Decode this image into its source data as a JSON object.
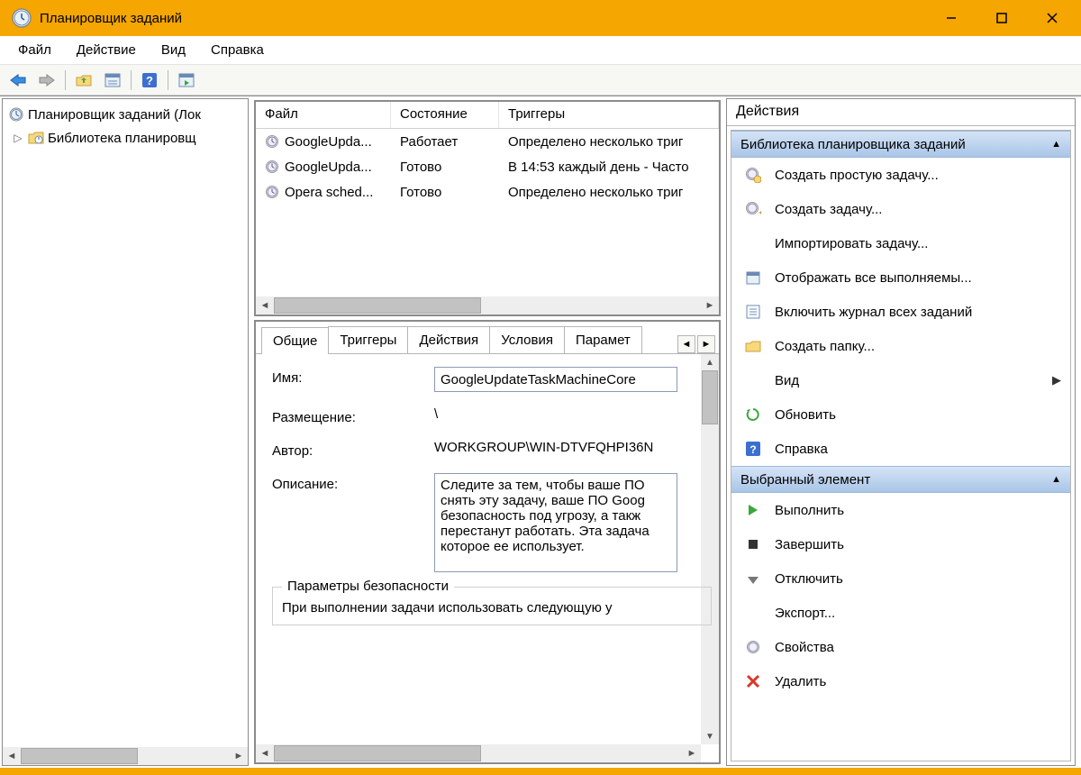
{
  "window": {
    "title": "Планировщик заданий"
  },
  "menu": {
    "file": "Файл",
    "action": "Действие",
    "view": "Вид",
    "help": "Справка"
  },
  "tree": {
    "root": "Планировщик заданий (Лок",
    "library": "Библиотека планировщ"
  },
  "table": {
    "headers": {
      "file": "Файл",
      "state": "Состояние",
      "triggers": "Триггеры"
    },
    "rows": [
      {
        "file": "GoogleUpda...",
        "state": "Работает",
        "triggers": "Определено несколько триг"
      },
      {
        "file": "GoogleUpda...",
        "state": "Готово",
        "triggers": "В 14:53 каждый день - Часто"
      },
      {
        "file": "Opera sched...",
        "state": "Готово",
        "triggers": "Определено несколько триг"
      }
    ]
  },
  "tabs": {
    "general": "Общие",
    "triggers": "Триггеры",
    "actions": "Действия",
    "conditions": "Условия",
    "params": "Парамет"
  },
  "detail": {
    "name_label": "Имя:",
    "name_value": "GoogleUpdateTaskMachineCore",
    "location_label": "Размещение:",
    "location_value": "\\",
    "author_label": "Автор:",
    "author_value": "WORKGROUP\\WIN-DTVFQHPI36N",
    "description_label": "Описание:",
    "description_value": "Следите за тем, чтобы ваше ПО снять эту задачу, ваше ПО Goog безопасность под угрозу, а такж перестанут работать. Эта задача которое ее использует.",
    "security_group": "Параметры безопасности",
    "security_text": "При выполнении задачи использовать следующую у"
  },
  "actions_pane": {
    "title": "Действия",
    "section1": "Библиотека планировщика заданий",
    "items1": [
      "Создать простую задачу...",
      "Создать задачу...",
      "Импортировать задачу...",
      "Отображать все выполняемы...",
      "Включить журнал всех заданий",
      "Создать папку...",
      "Вид",
      "Обновить",
      "Справка"
    ],
    "section2": "Выбранный элемент",
    "items2": [
      "Выполнить",
      "Завершить",
      "Отключить",
      "Экспорт...",
      "Свойства",
      "Удалить"
    ]
  }
}
